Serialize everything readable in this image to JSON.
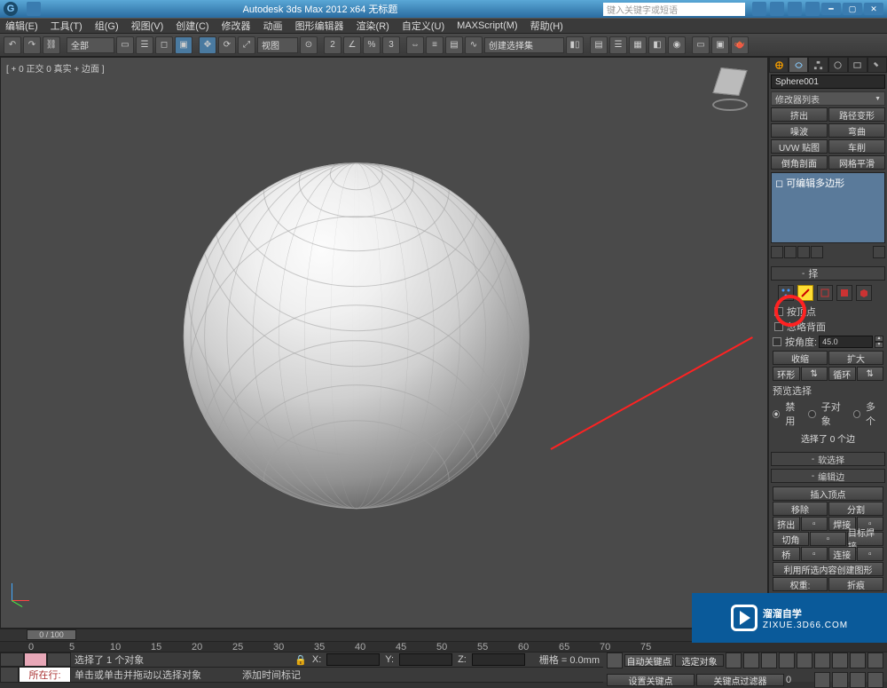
{
  "title": "Autodesk 3ds Max 2012  x64   无标题",
  "search_placeholder": "键入关键字或短语",
  "menu": [
    "编辑(E)",
    "工具(T)",
    "组(G)",
    "视图(V)",
    "创建(C)",
    "修改器",
    "动画",
    "图形编辑器",
    "渲染(R)",
    "自定义(U)",
    "MAXScript(M)",
    "帮助(H)"
  ],
  "toolbar": {
    "selset_dd": "全部",
    "view_dd": "视图",
    "named_dd": "创建选择集"
  },
  "viewport_label": "[ + 0 正交 0 真实 + 边面 ]",
  "panel": {
    "object_name": "Sphere001",
    "modlist_label": "修改器列表",
    "mod_buttons": [
      [
        "挤出",
        "路径变形"
      ],
      [
        "噪波",
        "弯曲"
      ],
      [
        "UVW 贴图",
        "车削"
      ],
      [
        "倒角剖面",
        "网格平滑"
      ]
    ],
    "stack_item": "可编辑多边形",
    "rollout_sel": "择",
    "chk_byvertex": "按顶点",
    "chk_ignore": "忽略背面",
    "chk_angle": "按角度:",
    "angle_val": "45.0",
    "btn_shrink": "收缩",
    "btn_grow": "扩大",
    "btn_ring": "环形",
    "btn_loop": "循环",
    "preview_lbl": "预览选择",
    "radio_off": "禁用",
    "radio_sub": "子对象",
    "radio_multi": "多个",
    "sel_info": "选择了 0 个边",
    "rollout_soft": "软选择",
    "rollout_edit": "编辑边",
    "btn_insvert": "插入顶点",
    "edit_rows": [
      [
        "移除",
        "分割"
      ],
      [
        "挤出",
        "焊接"
      ],
      [
        "切角",
        "目标焊接"
      ],
      [
        "桥",
        "连接"
      ]
    ],
    "btn_usecontent": "利用所选内容创建图形",
    "edit_rows2": [
      [
        "权重:",
        "折痕"
      ]
    ]
  },
  "timeline": {
    "handle": "0 / 100",
    "ticks": [
      "0",
      "5",
      "10",
      "15",
      "20",
      "25",
      "30",
      "35",
      "40",
      "45",
      "50",
      "55",
      "60",
      "65",
      "70",
      "75"
    ]
  },
  "status": {
    "curloc_label": "所在行:",
    "sel_line": "选择了 1 个对象",
    "hint_line": "单击或单击并拖动以选择对象",
    "addtime": "添加时间标记",
    "x": "X:",
    "y": "Y:",
    "z": "Z:",
    "grid": "栅格 = 0.0mm",
    "autokey": "自动关键点",
    "selkey": "选定对象",
    "setkey": "设置关键点",
    "keyfilter": "关键点过滤器"
  },
  "watermark": {
    "main": "溜溜自学",
    "sub": "ZIXUE.3D66.COM"
  }
}
